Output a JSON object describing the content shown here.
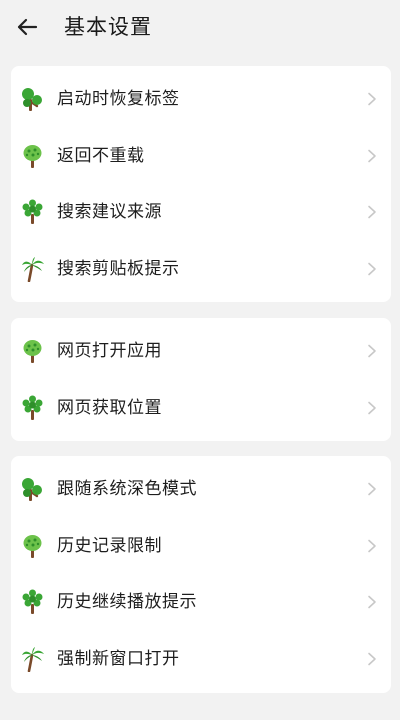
{
  "header": {
    "title": "基本设置",
    "back_icon": "arrow-left-icon"
  },
  "colors": {
    "background": "#f2f2f2",
    "card": "#ffffff",
    "text": "#1e1e1e",
    "chevron": "#c8c8c8",
    "icon_green": "#3aa635",
    "icon_trunk": "#7a4a2a"
  },
  "sections": [
    {
      "items": [
        {
          "label": "启动时恢复标签",
          "icon": "tree-icon"
        },
        {
          "label": "返回不重载",
          "icon": "tree-icon"
        },
        {
          "label": "搜索建议来源",
          "icon": "tree-icon"
        },
        {
          "label": "搜索剪贴板提示",
          "icon": "palm-tree-icon"
        }
      ]
    },
    {
      "items": [
        {
          "label": "网页打开应用",
          "icon": "tree-icon"
        },
        {
          "label": "网页获取位置",
          "icon": "tree-icon"
        }
      ]
    },
    {
      "items": [
        {
          "label": "跟随系统深色模式",
          "icon": "tree-icon"
        },
        {
          "label": "历史记录限制",
          "icon": "tree-icon"
        },
        {
          "label": "历史继续播放提示",
          "icon": "tree-icon"
        },
        {
          "label": "强制新窗口打开",
          "icon": "palm-tree-icon"
        }
      ]
    }
  ]
}
